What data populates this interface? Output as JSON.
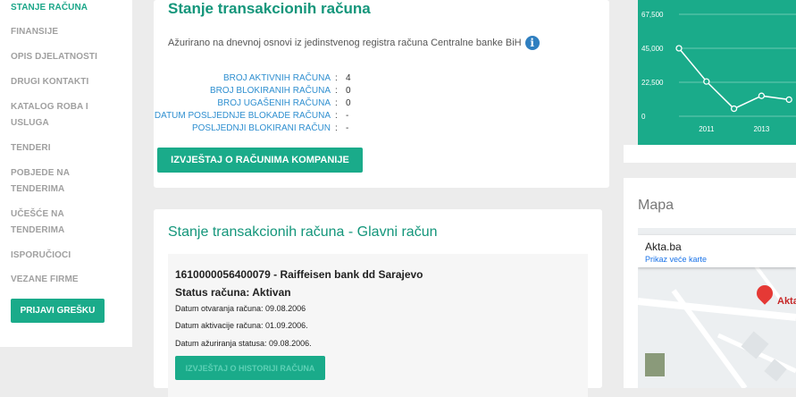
{
  "sidebar": {
    "items": [
      {
        "label": "STANJE RAČUNA"
      },
      {
        "label": "FINANSIJE"
      },
      {
        "label": "OPIS DJELATNOSTI"
      },
      {
        "label": "DRUGI KONTAKTI"
      },
      {
        "label": "KATALOG ROBA I USLUGA"
      },
      {
        "label": "TENDERI"
      },
      {
        "label": "POBJEDE NA TENDERIMA"
      },
      {
        "label": "UČEŠĆE NA TENDERIMA"
      },
      {
        "label": "ISPORUČIOCI"
      },
      {
        "label": "VEZANE FIRME"
      }
    ],
    "report_button": "PRIJAVI GREŠKU"
  },
  "accounts": {
    "title": "Stanje transakcionih računa",
    "subtitle": "Ažurirano na dnevnoj osnovi iz jedinstvenog registra računa Centralne banke BiH",
    "info_icon": "i",
    "stats": [
      {
        "label": "BROJ AKTIVNIH RAČUNA",
        "value": "4"
      },
      {
        "label": "BROJ BLOKIRANIH RAČUNA",
        "value": "0"
      },
      {
        "label": "BROJ UGAŠENIH RAČUNA",
        "value": "0"
      },
      {
        "label": "DATUM POSLJEDNJE BLOKADE RAČUNA",
        "value": "-"
      },
      {
        "label": "POSLJEDNJI BLOKIRANI RAČUN",
        "value": "-"
      }
    ],
    "separator": ":",
    "button": "IZVJEŠTAJ O RAČUNIMA KOMPANIJE"
  },
  "main_account": {
    "title": "Stanje transakcionih računa - Glavni račun",
    "number_bank": "1610000056400079 - Raiffeisen bank dd Sarajevo",
    "status": "Status računa: Aktivan",
    "opened": "Datum otvaranja računa: 09.08.2006",
    "activated": "Datum aktivacije računa: 01.09.2006.",
    "status_updated": "Datum ažuriranja statusa: 09.08.2006.",
    "history_button": "IZVJEŠTAJ O HISTORIJI RAČUNA"
  },
  "chart_data": {
    "type": "line",
    "x": [
      2010,
      2011,
      2012,
      2013,
      2014
    ],
    "x_tick_labels": [
      "2011",
      "2013"
    ],
    "y_tick_labels": [
      "67,500",
      "45,000",
      "22,500",
      "0"
    ],
    "values": [
      45000,
      23000,
      5000,
      13500,
      11000
    ],
    "ylim": [
      0,
      67500
    ],
    "background_color": "#1aab8a",
    "line_color": "#ffffff"
  },
  "map": {
    "title": "Mapa",
    "place_name": "Akta.ba",
    "bigger_map_link": "Prikaz veće karte",
    "marker_label": "Akta",
    "marker_color": "#e53935"
  }
}
